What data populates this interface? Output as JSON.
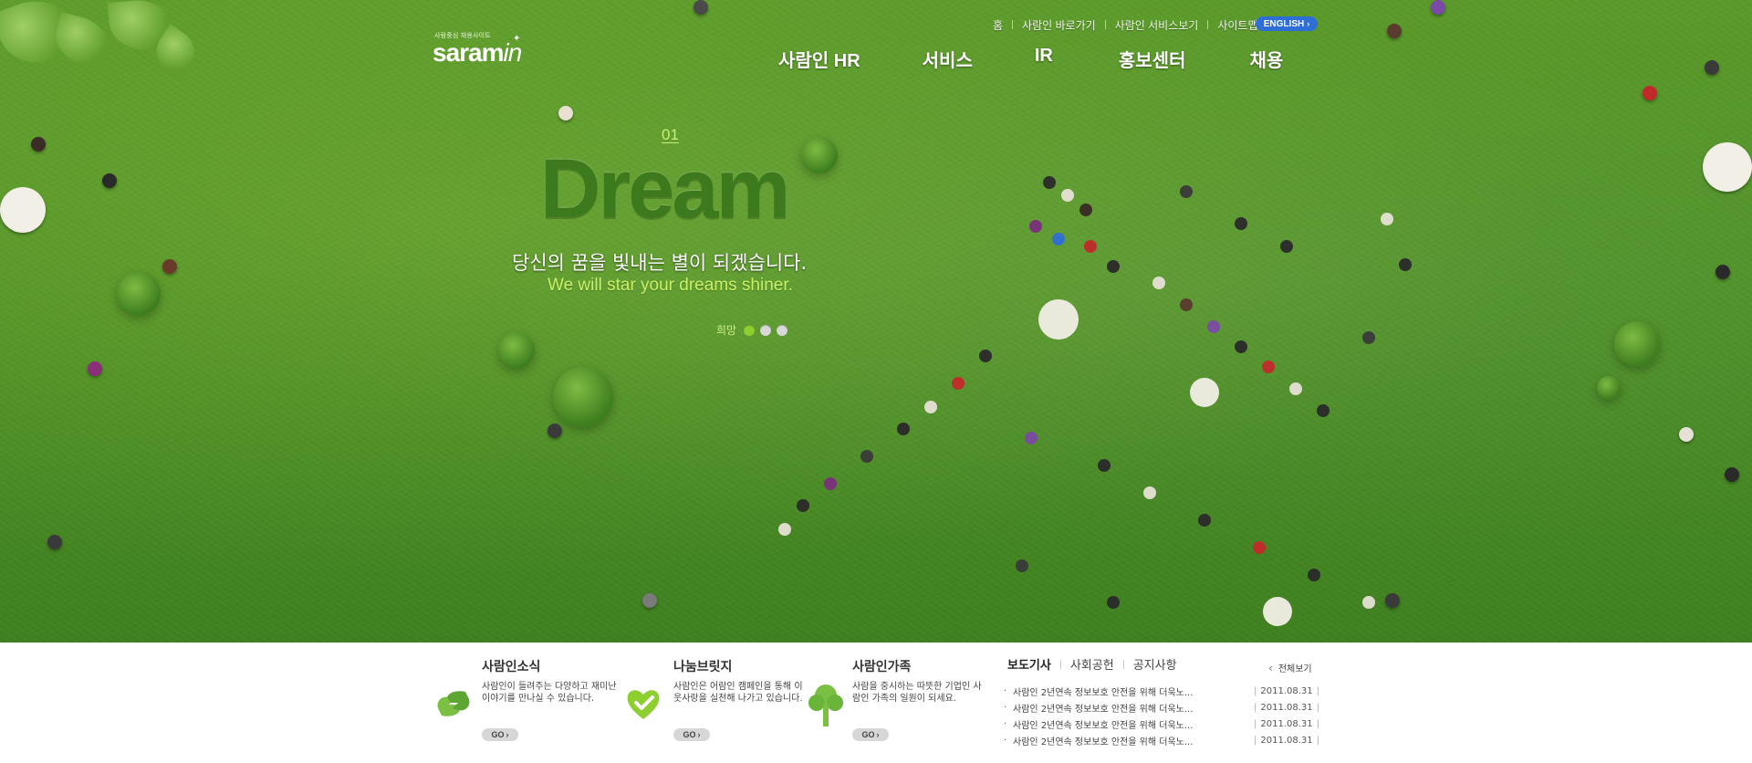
{
  "util_links": [
    "홈",
    "사람인 바로가기",
    "사람인 서비스보기",
    "사이트맵"
  ],
  "lang_button": "ENGLISH",
  "logo": {
    "tagline": "사람중심 채용사이트",
    "word": "saram",
    "suffix": "in"
  },
  "nav": [
    "사람인 HR",
    "서비스",
    "IR",
    "홍보센터",
    "채용"
  ],
  "slide": {
    "number": "01",
    "headline": "Dream",
    "korean": "당신의 꿈을 빛내는 별이 되겠습니다.",
    "english": "We will star your dreams shiner.",
    "label": "희망",
    "dots": [
      {
        "color": "#8ccf2f",
        "active": true
      },
      {
        "color": "#d8d8d8",
        "active": false
      },
      {
        "color": "#d8d8d8",
        "active": false
      }
    ]
  },
  "boxes": [
    {
      "title": "사람인소식",
      "desc": "사람인이 들려주는 다양하고 재미난 이야기를 만나실 수 있습니다.",
      "go": "GO",
      "icon": "hands-icon"
    },
    {
      "title": "나눔브릿지",
      "desc": "사람인은 어람인 캠페인을 통해 이웃사랑을 실천해 나가고 있습니다.",
      "go": "GO",
      "icon": "heart-icon"
    },
    {
      "title": "사람인가족",
      "desc": "사람을 중시하는 따뜻한 기업인 사람인 가족의 일원이 되세요.",
      "go": "GO",
      "icon": "tree-icon"
    }
  ],
  "news": {
    "tabs": [
      "보도기사",
      "사회공헌",
      "공지사항"
    ],
    "active_tab": "보도기사",
    "view_all": "전체보기",
    "items": [
      {
        "title": "사람인 2년연속 정보보호 안전을 위해 더욱노...",
        "date": "2011.08.31"
      },
      {
        "title": "사람인 2년연속 정보보호 안전을 위해 더욱노...",
        "date": "2011.08.31"
      },
      {
        "title": "사람인 2년연속 정보보호 안전을 위해 더욱노...",
        "date": "2011.08.31"
      },
      {
        "title": "사람인 2년연속 정보보호 안전을 위해 더욱노...",
        "date": "2011.08.31"
      }
    ]
  }
}
